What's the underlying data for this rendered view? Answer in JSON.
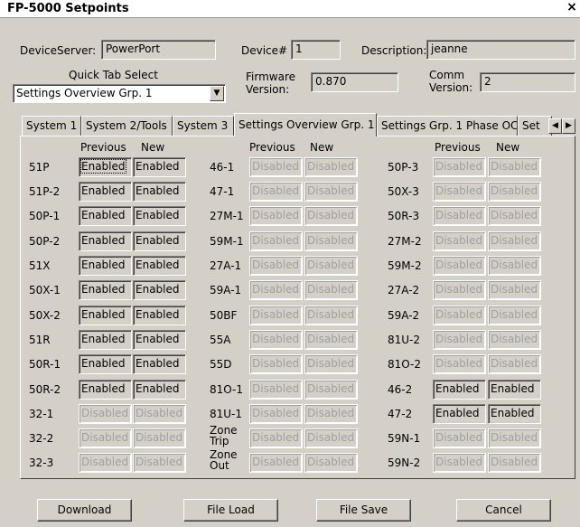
{
  "window": {
    "title": "FP-5000 Setpoints",
    "close_glyph": "×"
  },
  "top": {
    "device_server_label": "DeviceServer:",
    "device_server_value": "PowerPort",
    "device_num_label": "Device#",
    "device_num_value": "1",
    "description_label": "Description:",
    "description_value": "jeanne",
    "quick_tab_label": "Quick Tab Select",
    "quick_tab_value": "Settings Overview Grp. 1",
    "firmware_label_1": "Firmware",
    "firmware_label_2": "Version:",
    "firmware_value": "0.870",
    "comm_label_1": "Comm",
    "comm_label_2": "Version:",
    "comm_value": "2"
  },
  "tabs": [
    {
      "label": "System 1"
    },
    {
      "label": "System 2/Tools"
    },
    {
      "label": "System 3"
    },
    {
      "label": "Settings Overview Grp. 1"
    },
    {
      "label": "Settings Grp. 1 Phase OC"
    },
    {
      "label": "Set"
    }
  ],
  "headers": {
    "previous": "Previous",
    "new": "New"
  },
  "columns": [
    {
      "rows": [
        {
          "label": "51P",
          "prev": "Enabled",
          "new": "Enabled",
          "state": "en"
        },
        {
          "label": "51P-2",
          "prev": "Enabled",
          "new": "Enabled",
          "state": "en"
        },
        {
          "label": "50P-1",
          "prev": "Enabled",
          "new": "Enabled",
          "state": "en"
        },
        {
          "label": "50P-2",
          "prev": "Enabled",
          "new": "Enabled",
          "state": "en"
        },
        {
          "label": "51X",
          "prev": "Enabled",
          "new": "Enabled",
          "state": "en"
        },
        {
          "label": "50X-1",
          "prev": "Enabled",
          "new": "Enabled",
          "state": "en"
        },
        {
          "label": "50X-2",
          "prev": "Enabled",
          "new": "Enabled",
          "state": "en"
        },
        {
          "label": "51R",
          "prev": "Enabled",
          "new": "Enabled",
          "state": "en"
        },
        {
          "label": "50R-1",
          "prev": "Enabled",
          "new": "Enabled",
          "state": "en"
        },
        {
          "label": "50R-2",
          "prev": "Enabled",
          "new": "Enabled",
          "state": "en"
        },
        {
          "label": "32-1",
          "prev": "Disabled",
          "new": "Disabled",
          "state": "dis"
        },
        {
          "label": "32-2",
          "prev": "Disabled",
          "new": "Disabled",
          "state": "dis"
        },
        {
          "label": "32-3",
          "prev": "Disabled",
          "new": "Disabled",
          "state": "dis"
        }
      ]
    },
    {
      "rows": [
        {
          "label": "46-1",
          "prev": "Disabled",
          "new": "Disabled",
          "state": "dis"
        },
        {
          "label": "47-1",
          "prev": "Disabled",
          "new": "Disabled",
          "state": "dis"
        },
        {
          "label": "27M-1",
          "prev": "Disabled",
          "new": "Disabled",
          "state": "dis"
        },
        {
          "label": "59M-1",
          "prev": "Disabled",
          "new": "Disabled",
          "state": "dis"
        },
        {
          "label": "27A-1",
          "prev": "Disabled",
          "new": "Disabled",
          "state": "dis"
        },
        {
          "label": "59A-1",
          "prev": "Disabled",
          "new": "Disabled",
          "state": "dis"
        },
        {
          "label": "50BF",
          "prev": "Disabled",
          "new": "Disabled",
          "state": "dis"
        },
        {
          "label": "55A",
          "prev": "Disabled",
          "new": "Disabled",
          "state": "dis"
        },
        {
          "label": "55D",
          "prev": "Disabled",
          "new": "Disabled",
          "state": "dis"
        },
        {
          "label": "81O-1",
          "prev": "Disabled",
          "new": "Disabled",
          "state": "dis"
        },
        {
          "label": "81U-1",
          "prev": "Disabled",
          "new": "Disabled",
          "state": "dis"
        },
        {
          "label": "Zone Trip",
          "prev": "Disabled",
          "new": "Disabled",
          "state": "dis"
        },
        {
          "label": "Zone Out",
          "prev": "Disabled",
          "new": "Disabled",
          "state": "dis"
        }
      ]
    },
    {
      "rows": [
        {
          "label": "50P-3",
          "prev": "Disabled",
          "new": "Disabled",
          "state": "dis"
        },
        {
          "label": "50X-3",
          "prev": "Disabled",
          "new": "Disabled",
          "state": "dis"
        },
        {
          "label": "50R-3",
          "prev": "Disabled",
          "new": "Disabled",
          "state": "dis"
        },
        {
          "label": "27M-2",
          "prev": "Disabled",
          "new": "Disabled",
          "state": "dis"
        },
        {
          "label": "59M-2",
          "prev": "Disabled",
          "new": "Disabled",
          "state": "dis"
        },
        {
          "label": "27A-2",
          "prev": "Disabled",
          "new": "Disabled",
          "state": "dis"
        },
        {
          "label": "59A-2",
          "prev": "Disabled",
          "new": "Disabled",
          "state": "dis"
        },
        {
          "label": "81U-2",
          "prev": "Disabled",
          "new": "Disabled",
          "state": "dis"
        },
        {
          "label": "81O-2",
          "prev": "Disabled",
          "new": "Disabled",
          "state": "dis"
        },
        {
          "label": "46-2",
          "prev": "Enabled",
          "new": "Enabled",
          "state": "en"
        },
        {
          "label": "47-2",
          "prev": "Enabled",
          "new": "Enabled",
          "state": "en"
        },
        {
          "label": "59N-1",
          "prev": "Disabled",
          "new": "Disabled",
          "state": "dis"
        },
        {
          "label": "59N-2",
          "prev": "Disabled",
          "new": "Disabled",
          "state": "dis"
        }
      ]
    }
  ],
  "buttons": {
    "download": "Download",
    "file_load": "File Load",
    "file_save": "File Save",
    "cancel": "Cancel"
  },
  "icons": {
    "dropdown_arrow": "▼",
    "tab_scroll_left": "◀",
    "tab_scroll_right": "▶"
  }
}
